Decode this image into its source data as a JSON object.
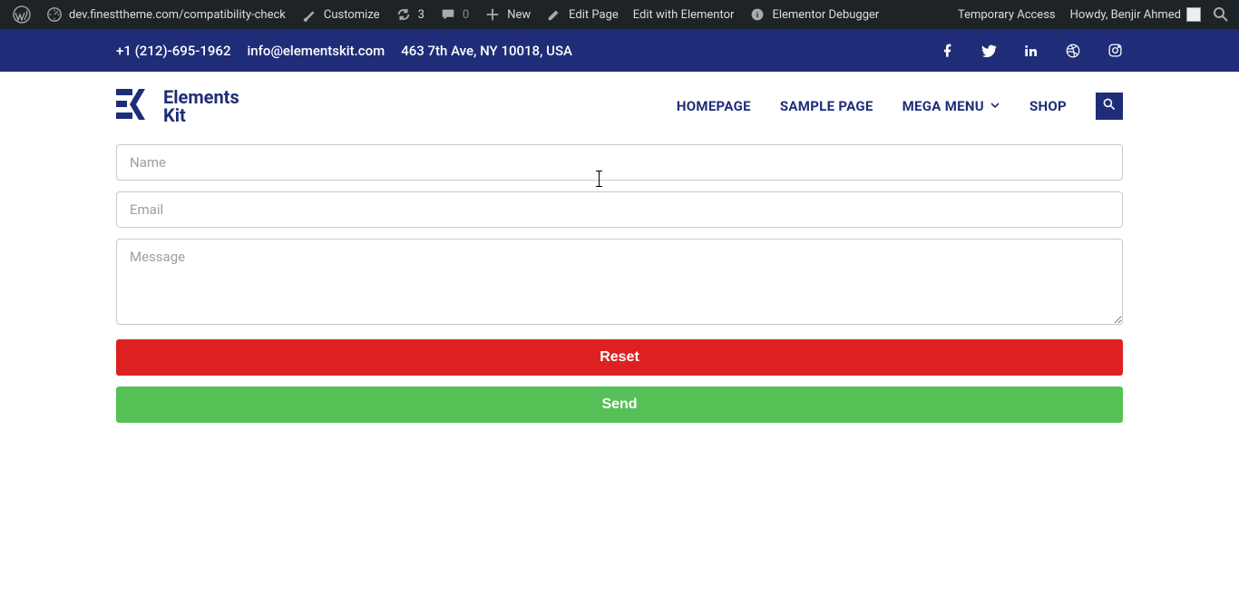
{
  "wpbar": {
    "site": "dev.finesttheme.com/compatibility-check",
    "customize": "Customize",
    "updates_count": "3",
    "comments_count": "0",
    "new": "New",
    "edit_page": "Edit Page",
    "edit_elementor": "Edit with Elementor",
    "elementor_debugger": "Elementor Debugger",
    "temporary_access": "Temporary Access",
    "howdy": "Howdy, Benjir Ahmed"
  },
  "topbar": {
    "phone": "+1 (212)-695-1962",
    "email": "info@elementskit.com",
    "address": "463 7th Ave, NY 10018, USA",
    "socials": [
      "facebook",
      "twitter",
      "linkedin",
      "dribbble",
      "instagram"
    ]
  },
  "logo": {
    "line1": "Elements",
    "line2": "Kit"
  },
  "nav": {
    "items": [
      {
        "label": "HOMEPAGE"
      },
      {
        "label": "SAMPLE PAGE"
      },
      {
        "label": "MEGA MENU",
        "dropdown": true
      },
      {
        "label": "SHOP"
      }
    ]
  },
  "form": {
    "name_placeholder": "Name",
    "email_placeholder": "Email",
    "message_placeholder": "Message",
    "reset_label": "Reset",
    "send_label": "Send"
  },
  "colors": {
    "brand": "#1f2d78",
    "reset": "#dd2121",
    "send": "#55c157"
  }
}
